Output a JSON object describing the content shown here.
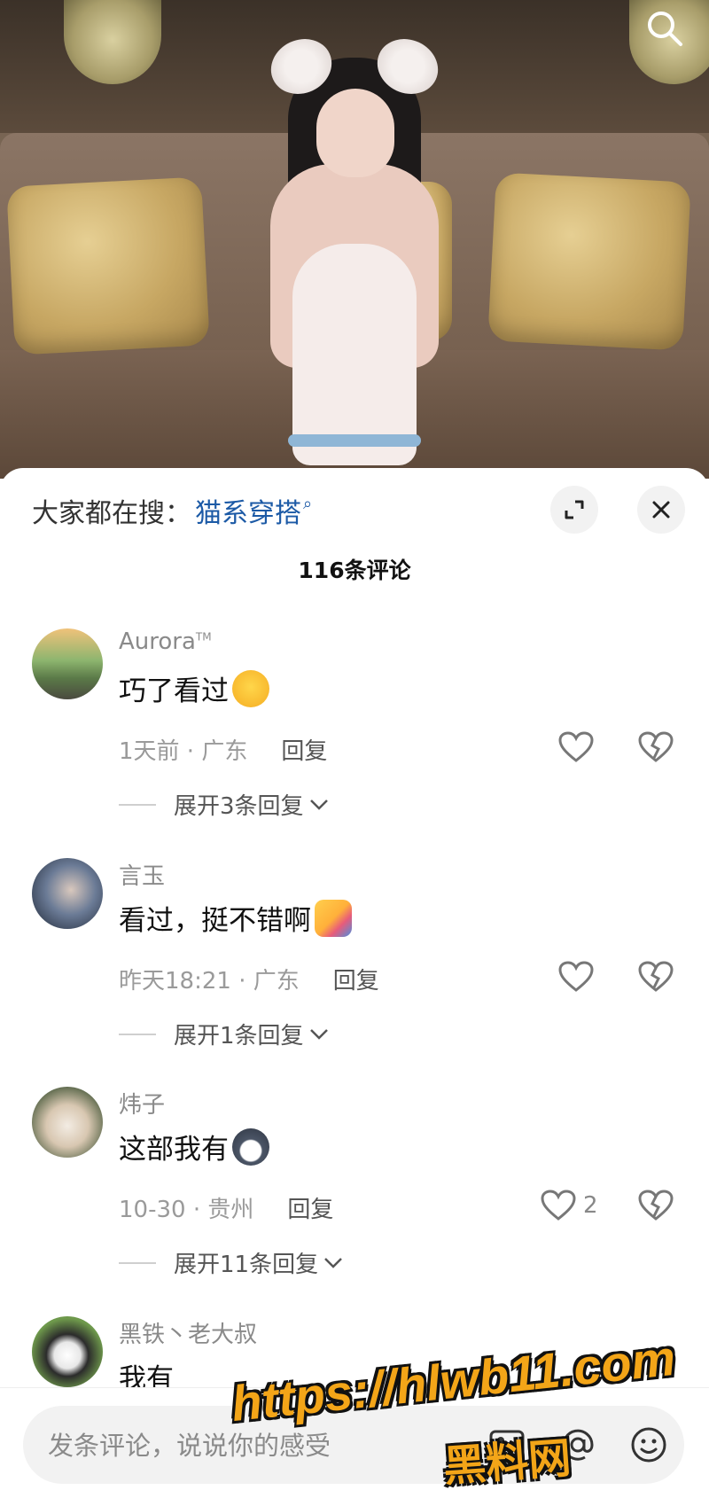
{
  "sheet": {
    "search_prefix": "大家都在搜：",
    "search_term": "猫系穿搭",
    "comment_count_label": "116条评论"
  },
  "comments": [
    {
      "username": "Aurora",
      "username_mark": "TM",
      "text": "巧了看过",
      "emoji": "blushing-face-emoji",
      "time_location": "1天前 · 广东",
      "reply_label": "回复",
      "likes": "",
      "expand_label": "展开3条回复"
    },
    {
      "username": "言玉",
      "text": "看过，挺不错啊",
      "emoji": "hugging-face-emoji",
      "time_location": "昨天18:21 · 广东",
      "reply_label": "回复",
      "likes": "",
      "expand_label": "展开1条回复"
    },
    {
      "username": "炜子",
      "text": "这部我有",
      "emoji": "husky-dog-emoji",
      "time_location": "10-30 · 贵州",
      "reply_label": "回复",
      "likes": "2",
      "expand_label": "展开11条回复"
    },
    {
      "username": "黑铁丶老大叔",
      "text": "我有"
    }
  ],
  "input": {
    "placeholder": "发条评论，说说你的感受"
  },
  "watermark": {
    "url": "https://hlwb11.com",
    "name": "黑料网"
  },
  "icons": {
    "search": "search-icon",
    "expand": "expand-icon",
    "close": "close-icon",
    "like": "heart-icon",
    "dislike": "broken-heart-icon",
    "image": "image-icon",
    "mention": "at-icon",
    "emoji": "smiley-icon"
  },
  "colors": {
    "search_term": "#1c5aa6",
    "watermark": "#f3a518"
  }
}
